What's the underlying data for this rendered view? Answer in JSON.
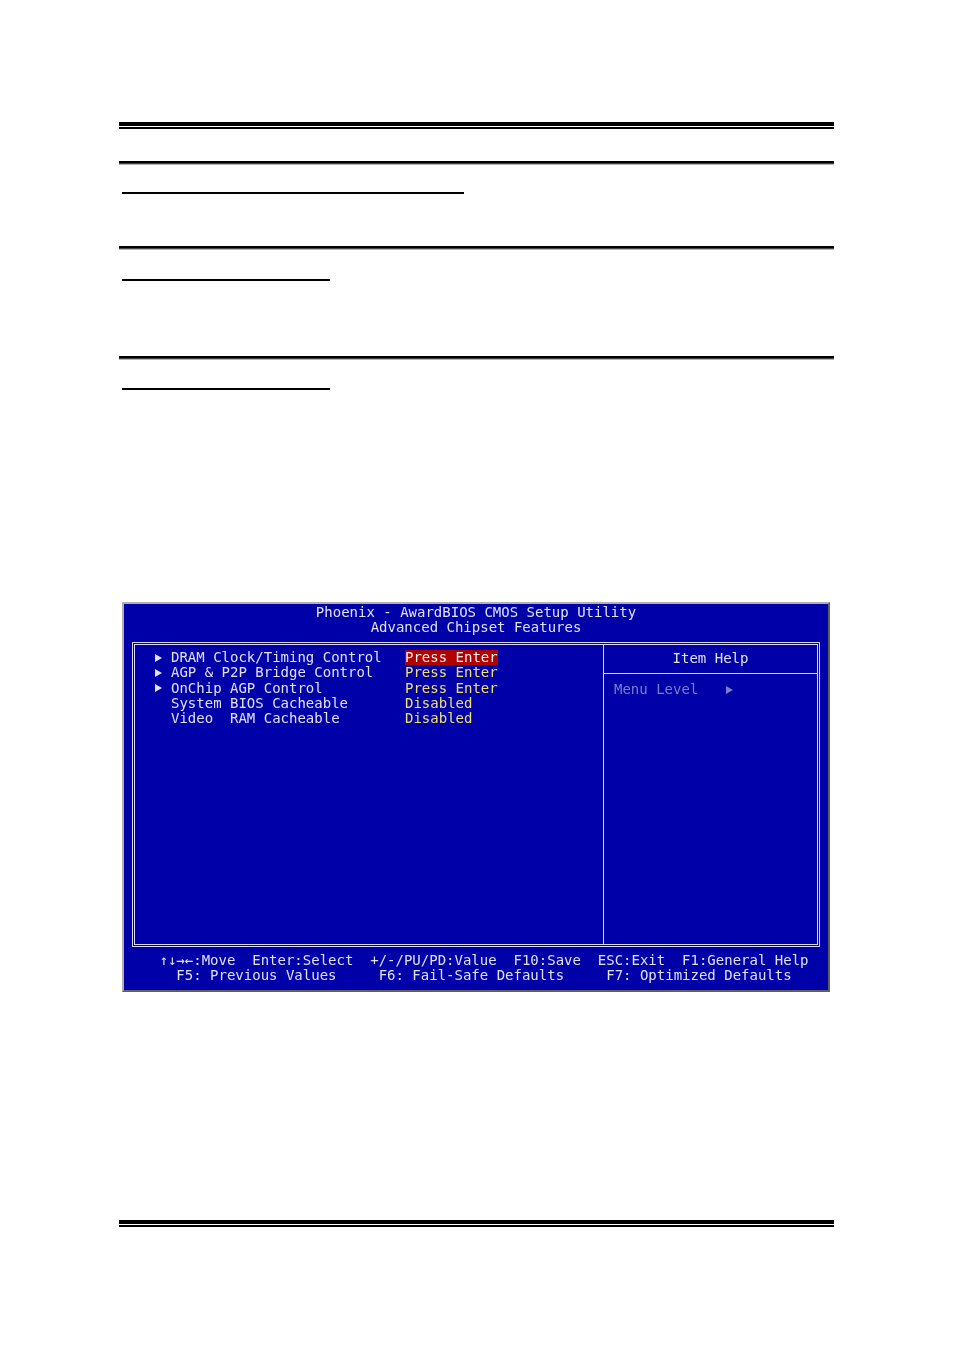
{
  "bios": {
    "title_lines": [
      "Phoenix - AwardBIOS CMOS Setup Utility",
      "Advanced Chipset Features"
    ],
    "items": [
      {
        "submenu": true,
        "label": "DRAM Clock/Timing Control",
        "value": "Press Enter",
        "selected": true
      },
      {
        "submenu": true,
        "label": "AGP & P2P Bridge Control",
        "value": "Press Enter",
        "selected": false
      },
      {
        "submenu": true,
        "label": "OnChip AGP Control",
        "value": "Press Enter",
        "selected": false
      },
      {
        "submenu": false,
        "label": "System BIOS Cacheable",
        "value": "Disabled",
        "selected": false
      },
      {
        "submenu": false,
        "label": "Video  RAM Cacheable",
        "value": "Disabled",
        "selected": false
      }
    ],
    "help": {
      "title": "Item Help",
      "menu_level": "Menu Level"
    },
    "footer_lines": [
      "↑↓→←:Move  Enter:Select  +/-/PU/PD:Value  F10:Save  ESC:Exit  F1:General Help",
      "F5: Previous Values     F6: Fail-Safe Defaults     F7: Optimized Defaults"
    ]
  }
}
